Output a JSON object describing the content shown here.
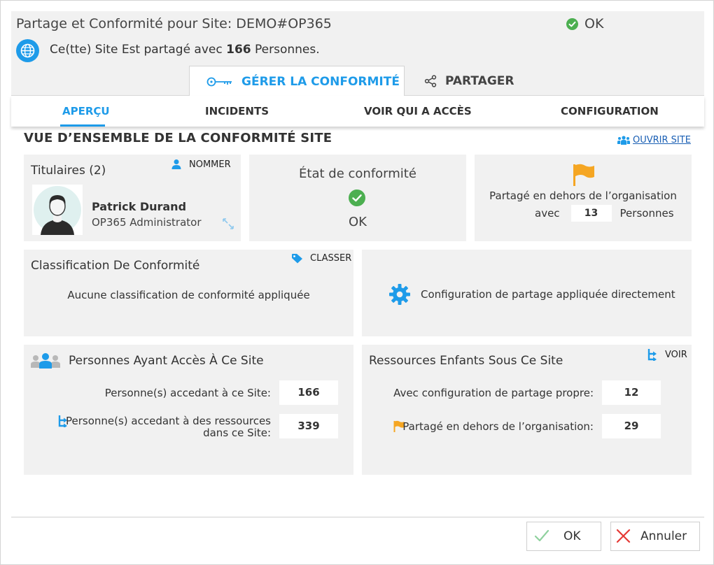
{
  "header": {
    "title": "Partage et Conformité pour Site: DEMO#OP365",
    "status": "OK",
    "shared_prefix": "Ce(tte) Site Est partagé avec ",
    "shared_count": "166",
    "shared_suffix": " Personnes."
  },
  "tabs": {
    "compliance": "GÉRER LA CONFORMITÉ",
    "share": "PARTAGER"
  },
  "subnav": {
    "overview": "APERÇU",
    "incidents": "INCIDENTS",
    "who_access": "VOIR QUI A ACCÈS",
    "configuration": "CONFIGURATION"
  },
  "section": {
    "title": "VUE D’ENSEMBLE DE LA CONFORMITÉ SITE",
    "open_site": "OUVRIR SITE"
  },
  "owners": {
    "heading": "Titulaires (2)",
    "action": "NOMMER",
    "name": "Patrick Durand",
    "role": "OP365 Administrator"
  },
  "state": {
    "label": "État de conformité",
    "value": "OK"
  },
  "external": {
    "line1": "Partagé en dehors de l’organisation",
    "with": "avec",
    "count": "13",
    "persons": "Personnes"
  },
  "classification": {
    "heading": "Classification De Conformité",
    "action": "CLASSER",
    "text": "Aucune classification de conformité appliquée"
  },
  "config": {
    "text": "Configuration de partage appliquée directement"
  },
  "people": {
    "heading": "Personnes Ayant Accès À Ce Site",
    "row1_label": "Personne(s) accedant à ce Site:",
    "row1_value": "166",
    "row2_label_a": "Personne(s) accedant à des ressources",
    "row2_label_b": "dans ce Site:",
    "row2_value": "339"
  },
  "children": {
    "heading": "Ressources Enfants Sous Ce Site",
    "action": "VOIR",
    "row1_label": "Avec configuration de partage propre:",
    "row1_value": "12",
    "row2_label": "Partagé en dehors de l’organisation:",
    "row2_value": "29"
  },
  "footer": {
    "ok": "OK",
    "cancel": "Annuler"
  },
  "colors": {
    "accent": "#1e9be9",
    "success": "#4caf50",
    "flag": "#f5a623",
    "danger": "#e53935"
  },
  "icons": {
    "status": "check-circle-icon",
    "globe": "globe-icon",
    "key": "key-icon",
    "share": "share-icon",
    "people": "people-icon",
    "user": "user-icon",
    "expand": "expand-icon",
    "flag": "flag-icon",
    "tag": "tag-icon",
    "gear": "gear-icon",
    "tree": "tree-icon",
    "ok": "check-icon",
    "cancel": "x-icon"
  }
}
